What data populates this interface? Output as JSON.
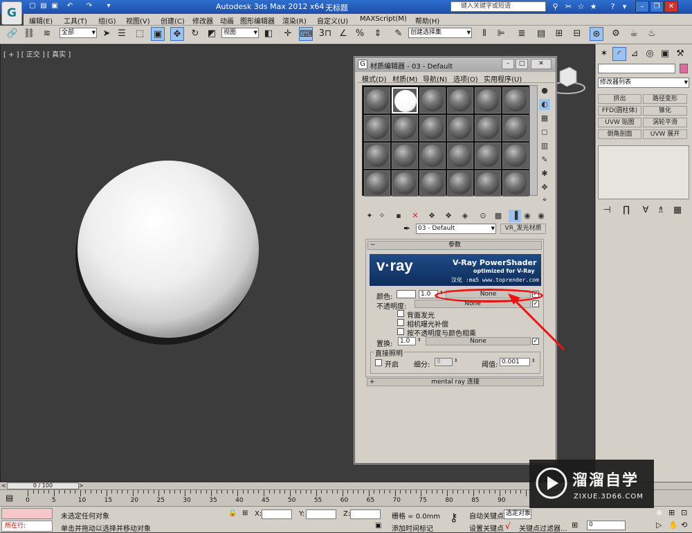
{
  "app": {
    "title": "Autodesk 3ds Max  2012 x64",
    "document": "无标题",
    "logo_text": "G",
    "search_placeholder": "键入关键字或短语"
  },
  "window_controls": {
    "minimize": "–",
    "restore": "❐",
    "close": "✕"
  },
  "menubar": [
    "编辑(E)",
    "工具(T)",
    "组(G)",
    "视图(V)",
    "创建(C)",
    "修改器",
    "动画",
    "图形编辑器",
    "渲染(R)",
    "自定义(U)",
    "MAXScript(M)",
    "帮助(H)"
  ],
  "toolbar": {
    "selection_filter": "全部",
    "ref_coord": "视图",
    "named_selection": "创建选择集"
  },
  "viewport": {
    "label": "[ + ] [ 正交 ] [ 真实 ]"
  },
  "command_panel": {
    "modifier_list": "修改器列表",
    "modifiers": [
      "挤出",
      "路径变形",
      "FFD(圆柱体)",
      "锥化",
      "UVW 贴图",
      "涡轮平滑",
      "倒角剖面",
      "UVW 展开"
    ]
  },
  "material_editor": {
    "title": "材质编辑器 - 03 - Default",
    "menu": [
      "模式(D)",
      "材质(M)",
      "导航(N)",
      "选项(O)",
      "实用程序(U)"
    ],
    "material_name": "03 - Default",
    "material_type": "VR_发光材质",
    "rollout_title": "参数",
    "banner": {
      "title": "V-Ray PowerShader",
      "subtitle": "optimized for V-Ray",
      "logo": "v·ray",
      "credit": "汉化 :ma5 www.toprender.com"
    },
    "color_label": "颜色:",
    "color_value": "1.0",
    "color_map": "None",
    "opacity_label": "不透明度:",
    "opacity_map": "None",
    "backside_label": "背面发光",
    "exposure_label": "相机曝光补偿",
    "multiply_label": "按不透明度与颜色相乘",
    "displace_label": "置换:",
    "displace_value": "1.0",
    "displace_map": "None",
    "direct_group": "直接照明",
    "direct_on_label": "开启",
    "subdivs_label": "细分:",
    "subdivs_value": "8",
    "threshold_label": "阈值:",
    "threshold_value": "0.001",
    "mental_ray": "mental ray 连接",
    "minus": "−",
    "plus": "+"
  },
  "timeline": {
    "frame_label": "0 / 100",
    "ticks": [
      "0",
      "5",
      "10",
      "15",
      "20",
      "25",
      "30",
      "35",
      "40",
      "45",
      "50",
      "55",
      "60",
      "65",
      "70",
      "75",
      "80",
      "85",
      "90"
    ]
  },
  "status": {
    "running": "所在行:",
    "message1": "未选定任何对象",
    "message2": "单击并拖动以选择并移动对象",
    "x_label": "X:",
    "y_label": "Y:",
    "z_label": "Z:",
    "grid": "栅格 = 0.0mm",
    "add_time_tag": "添加时间标记",
    "auto_key": "自动关键点",
    "set_key": "设置关键点",
    "key_mode": "选定对象",
    "key_filters": "关键点过滤器...",
    "frame_field": "0"
  },
  "watermark": {
    "brand": "溜溜自学",
    "url": "ZIXUE.3D66.COM"
  },
  "colors": {
    "title_blue": "#1d4fa8",
    "panel_gray": "#d4d0c8",
    "viewport_bg": "#3c3c3c",
    "highlight_red": "#e11111"
  }
}
